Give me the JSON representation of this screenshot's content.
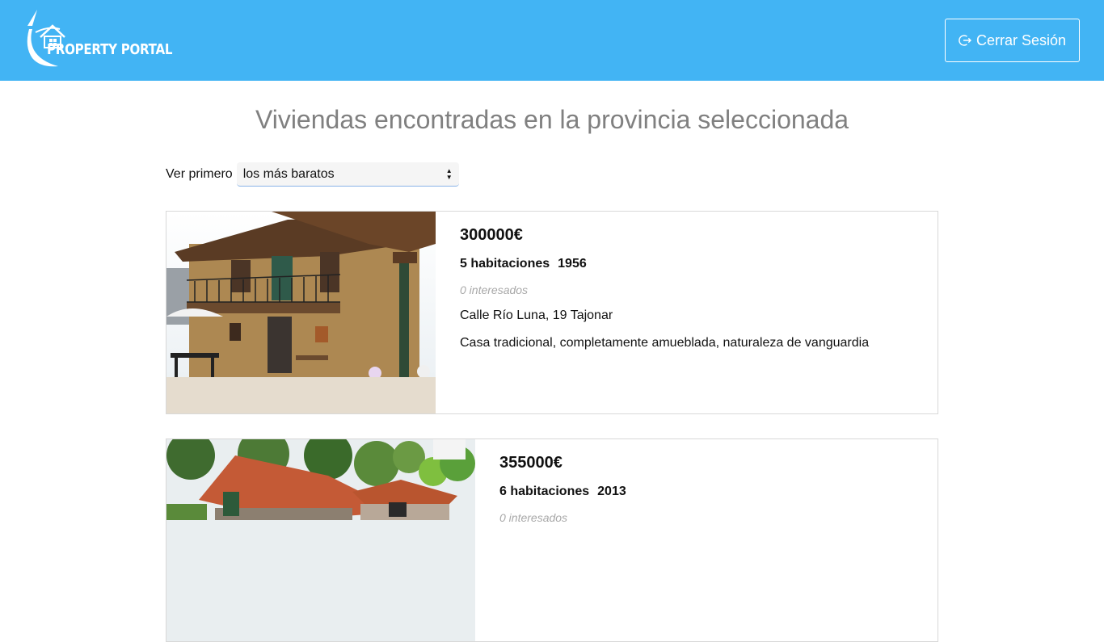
{
  "header": {
    "logo_text": "PROPERTY PORTAL",
    "logout_label": "Cerrar Sesión",
    "logout_icon": "logout-icon",
    "background": "#42b4f4"
  },
  "main": {
    "title": "Viviendas encontradas en la provincia seleccionada",
    "sort": {
      "label": "Ver primero",
      "selected": "los más baratos"
    },
    "listings": [
      {
        "price": "300000€",
        "rooms": "5 habitaciones",
        "year": "1956",
        "interested": "0 interesados",
        "address": "Calle Río Luna, 19 Tajonar",
        "description": "Casa tradicional, completamente amueblada, naturaleza de vanguardia"
      },
      {
        "price": "355000€",
        "rooms": "6 habitaciones",
        "year": "2013",
        "interested": "0 interesados"
      }
    ]
  }
}
